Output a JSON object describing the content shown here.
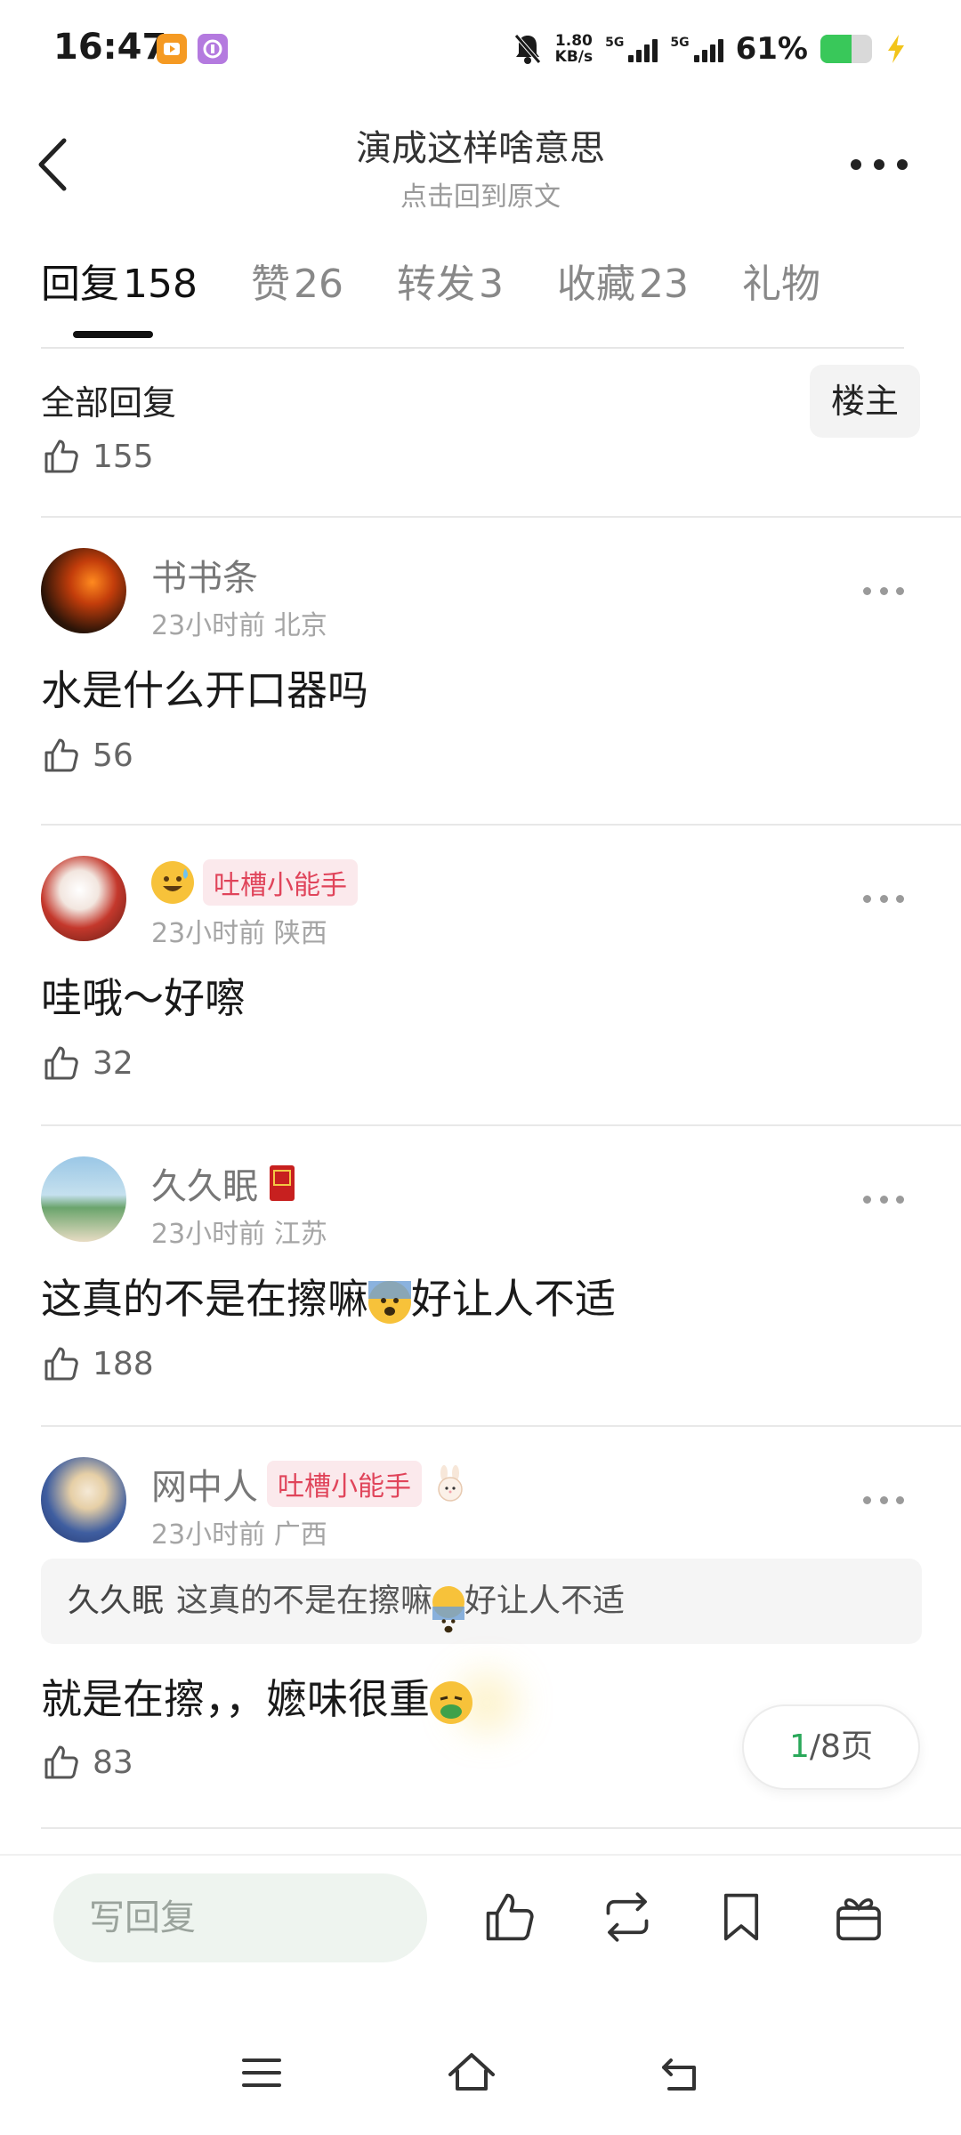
{
  "status_bar": {
    "time": "16:47",
    "net_speed_value": "1.80",
    "net_speed_unit": "KB/s",
    "sim1_label": "5G",
    "sim2_label": "5G",
    "battery_percent_text": "61%",
    "battery_level": 0.61,
    "icons": [
      "app-notification-icon-orange",
      "app-notification-icon-purple",
      "mute-bell-icon",
      "signal-icon",
      "battery-icon",
      "charging-bolt-icon"
    ]
  },
  "header": {
    "title": "演成这样啥意思",
    "subtitle": "点击回到原文",
    "back_icon": "chevron-left-icon",
    "more_icon": "more-dots-icon"
  },
  "tabs": [
    {
      "label": "回复",
      "count": "158",
      "active": true
    },
    {
      "label": "赞",
      "count": "26",
      "active": false
    },
    {
      "label": "转发",
      "count": "3",
      "active": false
    },
    {
      "label": "收藏",
      "count": "23",
      "active": false
    },
    {
      "label": "礼物",
      "count": "",
      "active": false
    }
  ],
  "filter": {
    "label": "全部回复",
    "owner_button": "楼主"
  },
  "top_likes": "155",
  "comments": [
    {
      "name": "书书条",
      "badge": "",
      "time": "23小时前",
      "location": "北京",
      "text": "水是什么开口器吗",
      "likes": "56",
      "avatar_color": "#5a2a10"
    },
    {
      "name": "",
      "badge": "吐槽小能手",
      "time": "23小时前",
      "location": "陕西",
      "text": "哇哦～好嚓",
      "likes": "32",
      "avatar_color": "#c0392b"
    },
    {
      "name": "久久眠",
      "badge": "",
      "time": "23小时前",
      "location": "江苏",
      "text_before": "这真的不是在擦嘛",
      "text_after": "好让人不适",
      "likes": "188",
      "avatar_color": "#6fa3c8"
    },
    {
      "name": "网中人",
      "badge": "吐槽小能手",
      "time": "23小时前",
      "location": "广西",
      "quote_name": "久久眠",
      "quote_before": "这真的不是在擦嘛",
      "quote_after": "好让人不适",
      "text": "就是在擦，，嬷味很重",
      "likes": "83",
      "avatar_color": "#4b6fb0"
    }
  ],
  "pagination": {
    "current": "1",
    "total": "/8页"
  },
  "bottom_bar": {
    "reply_placeholder": "写回复",
    "icons": [
      "like-icon",
      "repost-icon",
      "bookmark-icon",
      "gift-icon"
    ]
  },
  "nav_bar": {
    "icons": [
      "menu-icon",
      "home-icon",
      "back-icon"
    ]
  },
  "colors": {
    "accent_green": "#2aa85a",
    "badge_red": "#e0445a",
    "battery_green": "#39c85a"
  }
}
